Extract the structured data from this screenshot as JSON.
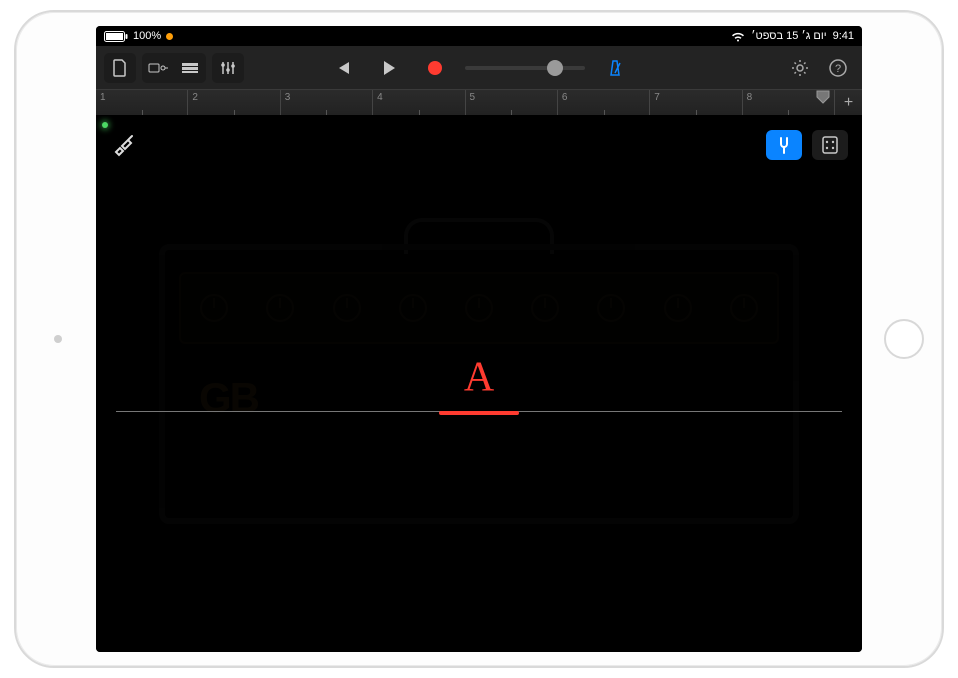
{
  "status": {
    "battery_pct": "100%",
    "battery_icon": "battery-full",
    "clock": "9:41",
    "date": "יום ג׳ 15 בספט׳"
  },
  "toolbar": {
    "left": {
      "my_songs_icon": "document-icon",
      "browser_icon": "browser-icon",
      "tracks_icon": "tracks-icon",
      "mixer_icon": "sliders-icon"
    },
    "transport": {
      "prev_icon": "skip-start-icon",
      "play_icon": "play-icon",
      "record_icon": "record-icon"
    },
    "volume_pct": 75,
    "metronome_icon": "metronome-icon",
    "right": {
      "settings_icon": "gear-icon",
      "help_icon": "help-icon"
    }
  },
  "ruler": {
    "bars": [
      "1",
      "2",
      "3",
      "4",
      "5",
      "6",
      "7",
      "8"
    ],
    "playhead_bar": 8,
    "add_label": "+"
  },
  "main": {
    "input_icon": "guitar-jack-icon",
    "tuner_icon": "tuning-fork-icon",
    "stomp_icon": "stompbox-icon",
    "tuner_active": true,
    "note": "A",
    "amp_logo": "GB"
  }
}
